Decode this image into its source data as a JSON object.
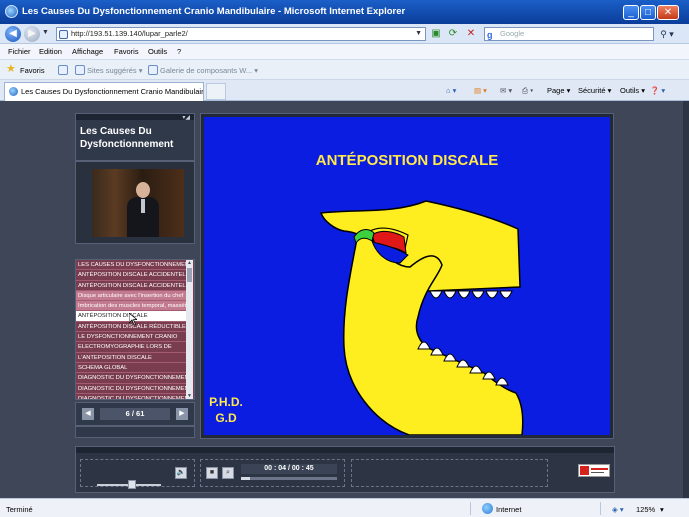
{
  "window": {
    "title": "Les Causes Du Dysfonctionnement Cranio Mandibulaire - Microsoft Internet Explorer",
    "minimize": "_",
    "maximize": "□",
    "close": "✕"
  },
  "address": {
    "url": "http://193.51.139.140/lupar_parle2/",
    "search_placeholder": "Google"
  },
  "menu": [
    "Fichier",
    "Edition",
    "Affichage",
    "Favoris",
    "Outils",
    "?"
  ],
  "favorites": {
    "label": "Favoris",
    "items": [
      "Sites suggérés ▾",
      "Galerie de composants W... ▾"
    ]
  },
  "tab": {
    "title": "Les Causes Du Dysfonctionnement Cranio Mandibulaire"
  },
  "commandbar": {
    "page": "Page ▾",
    "security": "Sécurité ▾",
    "tools": "Outils ▾"
  },
  "app": {
    "title": "Les Causes Du Dysfonctionnement",
    "chapters": [
      "LES CAUSES DU DYSFONCTIONNEMENT",
      "ANTÉPOSITION DISCALE ACCIDENTELLE",
      "ANTÉPOSITION DISCALE ACCIDENTELLE",
      "Disque articulaire avec l'insertion du chef",
      "Imbrication des muscles temporal, masséter",
      "ANTÉPOSITION DISCALE",
      "ANTÉPOSITION DISCALE RÉDUCTIBLE",
      "LE DYSFONCTIONNEMENT CRANIO",
      "ELECTROMYOGRAPHIE LORS DE",
      "L'ANTEPOSITION DISCALE",
      "SCHEMA GLOBAL",
      "DIAGNOSTIC DU DYSFONCTIONNEMENT",
      "DIAGNOSTIC DU DYSFONCTIONNEMENT",
      "DIAGNOSTIC DU DYSFONCTIONNEMENT"
    ],
    "active_chapter_index": 5,
    "page_counter": "6 / 61",
    "slide": {
      "title": "ANTÉPOSITION DISCALE",
      "author_line1": "P.H.D.",
      "author_line2": "G.D"
    },
    "player": {
      "time": "00 : 04 / 00 : 45",
      "progress": 0.089,
      "volume": 0.55
    }
  },
  "status": {
    "left": "Terminé",
    "zone": "Internet",
    "zoom": "125%"
  },
  "colors": {
    "slide_bg": "#0a1de0",
    "slide_text": "#ffe94a",
    "jaw": "#ffee1f",
    "disc": "#e01818",
    "ligament": "#3dd13d",
    "chapter_bg": "#7a3d4f"
  }
}
